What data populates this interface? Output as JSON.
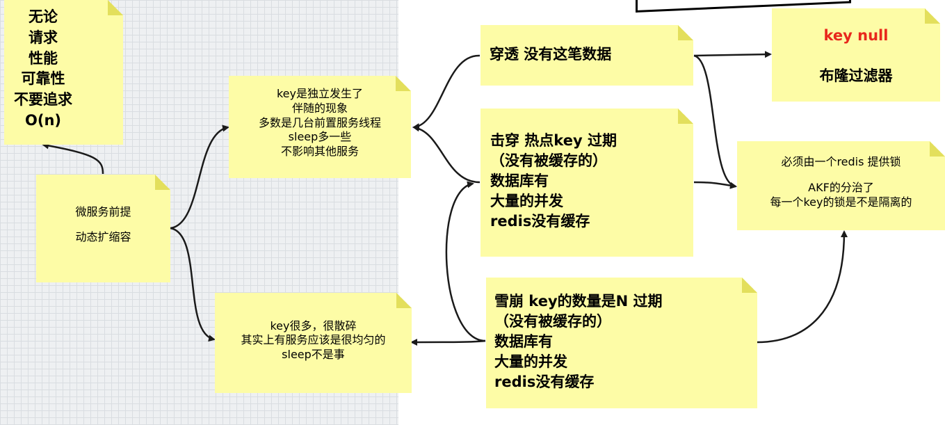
{
  "notes": {
    "principles": {
      "lines": [
        "无论",
        "请求",
        "性能",
        "可靠性",
        "不要追求",
        "O(n)"
      ]
    },
    "microservice": {
      "lines": [
        "微服务前提",
        "",
        "动态扩缩容"
      ]
    },
    "independent": {
      "lines": [
        "key是独立发生了",
        "伴随的现象",
        "多数是几台前置服务线程",
        "sleep多一些",
        "不影响其他服务"
      ]
    },
    "scattered": {
      "lines": [
        "key很多，很散碎",
        "其实上有服务应该是很均匀的",
        "sleep不是事"
      ]
    },
    "penetration": {
      "lines": [
        "穿透  没有这笔数据"
      ]
    },
    "breakdown": {
      "lines": [
        "击穿  热点key 过期",
        "（没有被缓存的）",
        "数据库有",
        "大量的并发",
        "redis没有缓存"
      ]
    },
    "avalanche": {
      "lines": [
        "雪崩  key的数量是N 过期",
        "（没有被缓存的）",
        "数据库有",
        "大量的并发",
        "redis没有缓存"
      ]
    },
    "bloom": {
      "title": "key null",
      "subtitle": "布隆过滤器"
    },
    "lock": {
      "lines": [
        "必须由一个redis 提供锁",
        "",
        "AKF的分治了",
        "每一个key的锁是不是隔离的"
      ]
    }
  },
  "colors": {
    "note": "#fdfca6",
    "fold": "#e3df5c",
    "highlight": "#e8281c",
    "arrow": "#1a1a1a",
    "grid_background": "#eef0f2"
  }
}
